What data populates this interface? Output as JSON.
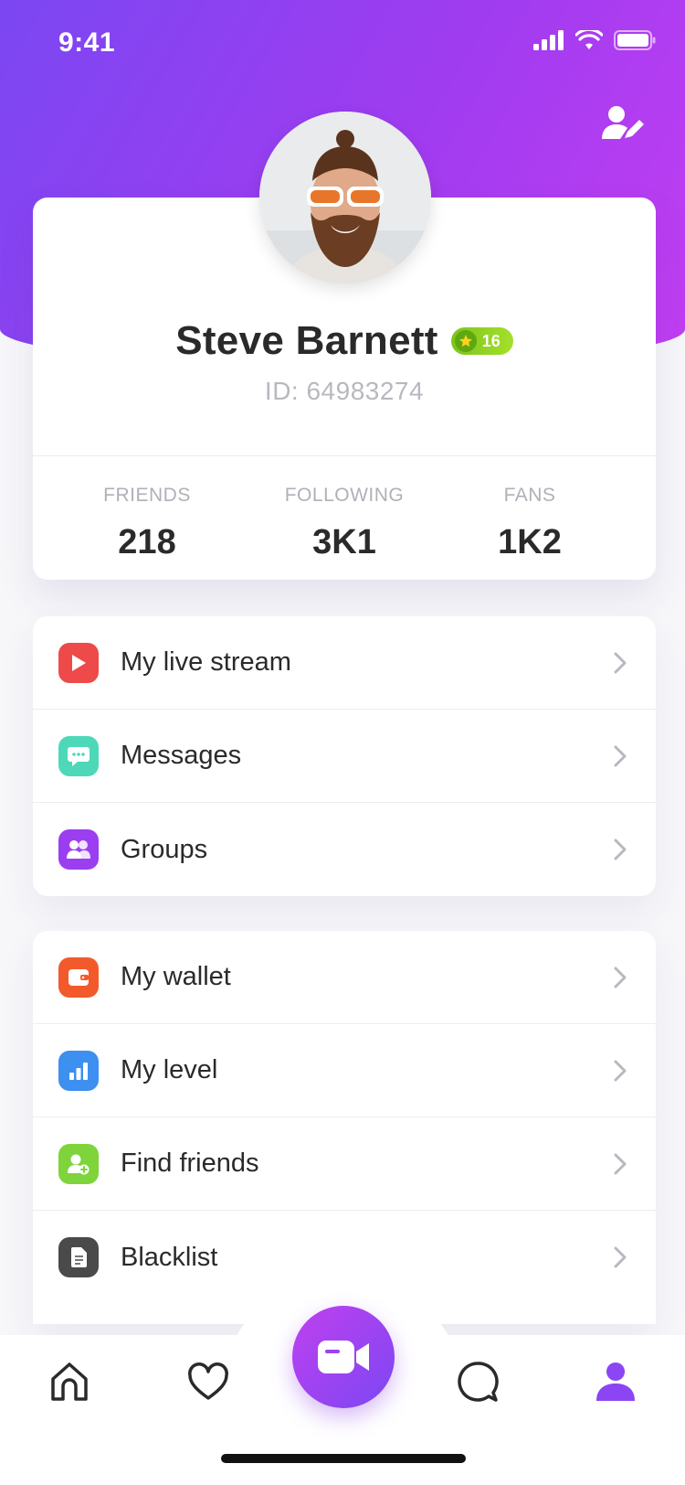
{
  "status_bar": {
    "time": "9:41"
  },
  "profile": {
    "name": "Steve Barnett",
    "level": "16",
    "id_text": "ID: 64983274",
    "stats": [
      {
        "label": "FRIENDS",
        "value": "218"
      },
      {
        "label": "FOLLOWING",
        "value": "3K1"
      },
      {
        "label": "FANS",
        "value": "1K2"
      }
    ]
  },
  "menu_group_1": [
    {
      "label": "My live stream",
      "icon": "play-icon",
      "color": "#ee4a4a"
    },
    {
      "label": "Messages",
      "icon": "chat-icon",
      "color": "#4dd9b8"
    },
    {
      "label": "Groups",
      "icon": "group-icon",
      "color": "#9b3ef0"
    }
  ],
  "menu_group_2": [
    {
      "label": "My wallet",
      "icon": "wallet-icon",
      "color": "#f25a2b"
    },
    {
      "label": "My level",
      "icon": "bar-chart-icon",
      "color": "#3d8ff0"
    },
    {
      "label": "Find friends",
      "icon": "add-user-icon",
      "color": "#7ed43a"
    },
    {
      "label": "Blacklist",
      "icon": "document-icon",
      "color": "#4a4a4a"
    }
  ],
  "tab_bar": {
    "tabs": [
      "home-icon",
      "heart-icon",
      "video-camera-icon",
      "chat-bubble-icon",
      "profile-icon"
    ],
    "active_tab": "profile-icon",
    "accent": "#8b45f2"
  }
}
